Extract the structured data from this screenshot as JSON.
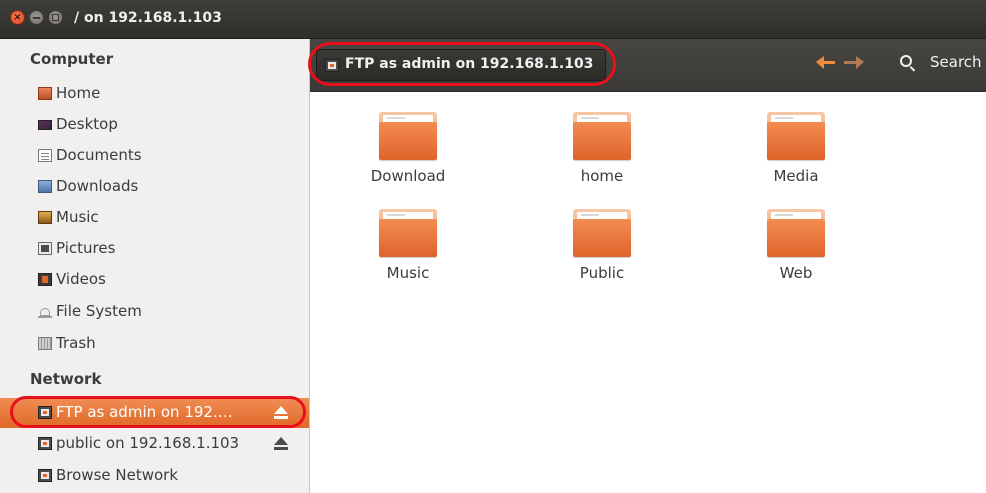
{
  "window": {
    "title": "/ on 192.168.1.103",
    "close_glyph": "×"
  },
  "sidebar": {
    "computer_heading": "Computer",
    "network_heading": "Network",
    "computer_items": [
      {
        "label": "Home",
        "icon": "home-folder-icon"
      },
      {
        "label": "Desktop",
        "icon": "desktop-icon"
      },
      {
        "label": "Documents",
        "icon": "documents-icon"
      },
      {
        "label": "Downloads",
        "icon": "downloads-icon"
      },
      {
        "label": "Music",
        "icon": "music-icon"
      },
      {
        "label": "Pictures",
        "icon": "pictures-icon"
      },
      {
        "label": "Videos",
        "icon": "videos-icon"
      },
      {
        "label": "File System",
        "icon": "drive-icon"
      },
      {
        "label": "Trash",
        "icon": "trash-icon"
      }
    ],
    "network_items": [
      {
        "label": "FTP as admin on 192.…",
        "icon": "network-share-icon",
        "selected": true,
        "ejectable": true
      },
      {
        "label": "public on 192.168.1.103",
        "icon": "network-share-icon",
        "selected": false,
        "ejectable": true
      },
      {
        "label": "Browse Network",
        "icon": "network-icon",
        "selected": false,
        "ejectable": false
      }
    ]
  },
  "toolbar": {
    "breadcrumb_label": "FTP as admin on 192.168.1.103",
    "search_label": "Search"
  },
  "folders": [
    {
      "label": "Download"
    },
    {
      "label": "home"
    },
    {
      "label": "Media"
    },
    {
      "label": "Music"
    },
    {
      "label": "Public"
    },
    {
      "label": "Web"
    }
  ],
  "colors": {
    "accent_orange": "#e06827",
    "highlight_red": "#e8101a",
    "titlebar_dark": "#3c3b37"
  }
}
